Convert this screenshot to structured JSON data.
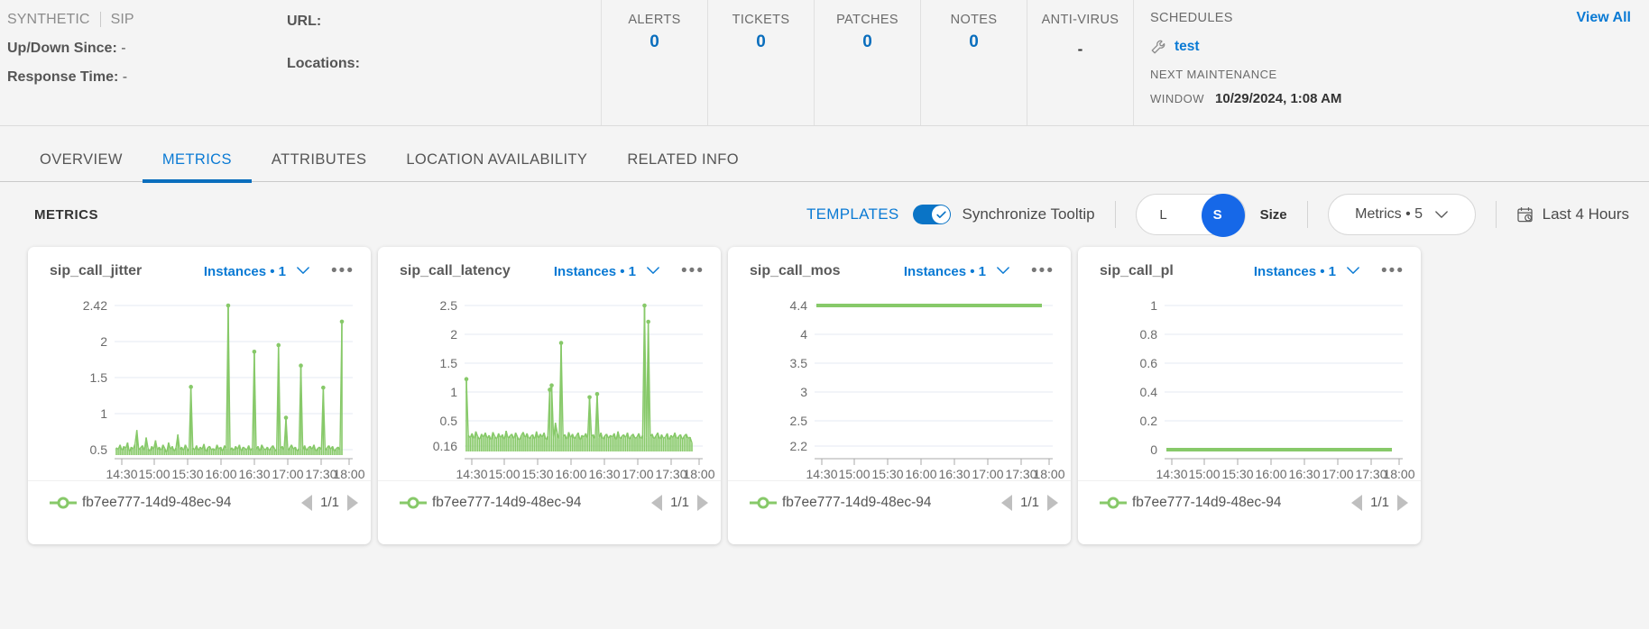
{
  "header": {
    "breadcrumbs": [
      "SYNTHETIC",
      "SIP"
    ],
    "left_fields": [
      {
        "label": "Up/Down Since:",
        "value": "-"
      },
      {
        "label": "Response Time:",
        "value": "-"
      }
    ],
    "mid_fields": [
      {
        "label": "URL:",
        "value": ""
      },
      {
        "label": "Locations:",
        "value": ""
      }
    ],
    "stats": [
      {
        "label": "ALERTS",
        "value": "0"
      },
      {
        "label": "TICKETS",
        "value": "0"
      },
      {
        "label": "PATCHES",
        "value": "0"
      },
      {
        "label": "NOTES",
        "value": "0"
      },
      {
        "label": "ANTI-VIRUS",
        "value": "-"
      }
    ],
    "schedules": {
      "title": "SCHEDULES",
      "view_all": "View All",
      "item_icon": "wrench-icon",
      "item_name": "test",
      "next_maintenance_label": "NEXT MAINTENANCE",
      "window_label": "WINDOW",
      "window_value": "10/29/2024, 1:08 AM"
    }
  },
  "tabs": [
    {
      "label": "OVERVIEW",
      "active": false
    },
    {
      "label": "METRICS",
      "active": true
    },
    {
      "label": "ATTRIBUTES",
      "active": false
    },
    {
      "label": "LOCATION AVAILABILITY",
      "active": false
    },
    {
      "label": "RELATED INFO",
      "active": false
    }
  ],
  "toolbar": {
    "title": "METRICS",
    "templates_label": "TEMPLATES",
    "sync_toggle_on": true,
    "sync_label": "Synchronize Tooltip",
    "size_options": [
      "L",
      "S"
    ],
    "size_selected": "S",
    "size_label": "Size",
    "metrics_select": "Metrics • 5",
    "time_range": "Last 4 Hours"
  },
  "colors": {
    "accent_blue": "#0a7ad4",
    "series_green": "#87c969",
    "toggle_blue": "#1668e8"
  },
  "legend_nav": {
    "page": "1/1",
    "prev": "prev-instance",
    "next": "next-instance"
  },
  "series_name": "fb7ee777-14d9-48ec-94",
  "x_ticks": [
    "14:30",
    "15:00",
    "15:30",
    "16:00",
    "16:30",
    "17:00",
    "17:30",
    "18:00"
  ],
  "cards": [
    {
      "title": "sip_call_jitter",
      "instances": "Instances • 1"
    },
    {
      "title": "sip_call_latency",
      "instances": "Instances • 1"
    },
    {
      "title": "sip_call_mos",
      "instances": "Instances • 1"
    },
    {
      "title": "sip_call_pl",
      "instances": "Instances • 1"
    }
  ],
  "chart_data": [
    {
      "type": "line",
      "title": "sip_call_jitter",
      "xlabel": "",
      "ylabel": "",
      "grid": true,
      "legend_position": "bottom",
      "series_name": "fb7ee777-14d9-48ec-94",
      "color": "#87c969",
      "x_ticks": [
        "14:30",
        "15:00",
        "15:30",
        "16:00",
        "16:30",
        "17:00",
        "17:30",
        "18:00"
      ],
      "y_ticks": [
        "2.42",
        "2",
        "1.5",
        "1",
        "0.5"
      ],
      "ylim": [
        0.38,
        2.42
      ],
      "values": [
        0.48,
        0.46,
        0.52,
        0.44,
        0.5,
        0.47,
        0.55,
        0.42,
        0.49,
        0.46,
        0.53,
        0.72,
        0.45,
        0.48,
        0.51,
        0.44,
        0.62,
        0.47,
        0.43,
        0.5,
        0.46,
        0.58,
        0.45,
        0.49,
        0.44,
        0.52,
        0.47,
        0.41,
        0.55,
        0.46,
        0.5,
        0.43,
        0.48,
        0.66,
        0.45,
        0.49,
        0.44,
        0.52,
        0.47,
        0.43,
        1.31,
        0.48,
        0.45,
        0.51,
        0.44,
        0.49,
        0.46,
        0.53,
        0.42,
        0.48,
        0.5,
        0.45,
        0.47,
        0.44,
        0.52,
        0.46,
        0.49,
        0.43,
        0.51,
        0.47,
        2.42,
        0.45,
        0.48,
        0.44,
        0.5,
        0.46,
        0.52,
        0.43,
        0.49,
        0.47,
        0.45,
        0.51,
        0.44,
        0.48,
        1.79,
        0.46,
        0.5,
        0.43,
        0.52,
        0.47,
        0.45,
        0.49,
        0.44,
        0.48,
        0.51,
        0.46,
        0.43,
        1.88,
        0.47,
        0.5,
        0.45,
        0.89,
        0.44,
        0.48,
        0.52,
        0.46,
        0.49,
        0.43,
        0.47,
        1.6,
        0.45,
        0.51,
        0.44,
        0.48,
        0.5,
        0.46,
        0.52,
        0.43,
        0.47,
        0.49,
        0.45,
        1.3,
        0.44,
        0.48,
        0.51,
        0.46,
        0.5,
        0.43,
        0.47,
        0.49,
        0.45,
        2.2
      ]
    },
    {
      "type": "line",
      "title": "sip_call_latency",
      "xlabel": "",
      "ylabel": "",
      "grid": true,
      "legend_position": "bottom",
      "series_name": "fb7ee777-14d9-48ec-94",
      "color": "#87c969",
      "x_ticks": [
        "14:30",
        "15:00",
        "15:30",
        "16:00",
        "16:30",
        "17:00",
        "17:30",
        "18:00"
      ],
      "y_ticks": [
        "2.5",
        "2",
        "1.5",
        "1",
        "0.5",
        "0.16"
      ],
      "ylim": [
        0.16,
        2.5
      ],
      "values": [
        1.32,
        0.42,
        0.38,
        0.45,
        0.36,
        0.48,
        0.4,
        0.35,
        0.44,
        0.39,
        0.46,
        0.37,
        0.42,
        0.34,
        0.47,
        0.4,
        0.36,
        0.45,
        0.38,
        0.43,
        0.35,
        0.49,
        0.37,
        0.41,
        0.44,
        0.36,
        0.46,
        0.39,
        0.34,
        0.42,
        0.47,
        0.38,
        0.45,
        0.36,
        0.4,
        0.43,
        0.35,
        0.48,
        0.37,
        0.44,
        0.39,
        0.46,
        0.34,
        0.41,
        1.15,
        1.22,
        0.37,
        0.62,
        0.45,
        0.36,
        1.9,
        0.4,
        0.43,
        0.35,
        0.47,
        0.38,
        0.44,
        0.36,
        0.41,
        0.46,
        0.34,
        0.42,
        0.39,
        0.45,
        0.37,
        1.03,
        0.4,
        0.43,
        0.36,
        1.08,
        0.38,
        0.46,
        0.35,
        0.41,
        0.44,
        0.37,
        0.42,
        0.39,
        0.45,
        0.34,
        0.48,
        0.36,
        0.4,
        0.43,
        0.38,
        0.46,
        0.35,
        0.41,
        0.44,
        0.37,
        0.39,
        0.45,
        0.36,
        0.42,
        2.5,
        0.38,
        2.24,
        0.4,
        0.44,
        0.36,
        0.41,
        0.46,
        0.35,
        0.43,
        0.37,
        0.39,
        0.45,
        0.34,
        0.42,
        0.38,
        0.46,
        0.36,
        0.4,
        0.43,
        0.35,
        0.41,
        0.44,
        0.37,
        0.39,
        0.3
      ]
    },
    {
      "type": "line",
      "title": "sip_call_mos",
      "xlabel": "",
      "ylabel": "",
      "grid": true,
      "legend_position": "bottom",
      "series_name": "fb7ee777-14d9-48ec-94",
      "color": "#87c969",
      "x_ticks": [
        "14:30",
        "15:00",
        "15:30",
        "16:00",
        "16:30",
        "17:00",
        "17:30",
        "18:00"
      ],
      "y_ticks": [
        "4.4",
        "4",
        "3.5",
        "3",
        "2.5",
        "2.2"
      ],
      "ylim": [
        2.2,
        4.4
      ],
      "constant_value": 4.4
    },
    {
      "type": "line",
      "title": "sip_call_pl",
      "xlabel": "",
      "ylabel": "",
      "grid": true,
      "legend_position": "bottom",
      "series_name": "fb7ee777-14d9-48ec-94",
      "color": "#87c969",
      "x_ticks": [
        "14:30",
        "15:00",
        "15:30",
        "16:00",
        "16:30",
        "17:00",
        "17:30",
        "18:00"
      ],
      "y_ticks": [
        "1",
        "0.8",
        "0.6",
        "0.4",
        "0.2",
        "0"
      ],
      "ylim": [
        0,
        1
      ],
      "constant_value": 0
    }
  ]
}
